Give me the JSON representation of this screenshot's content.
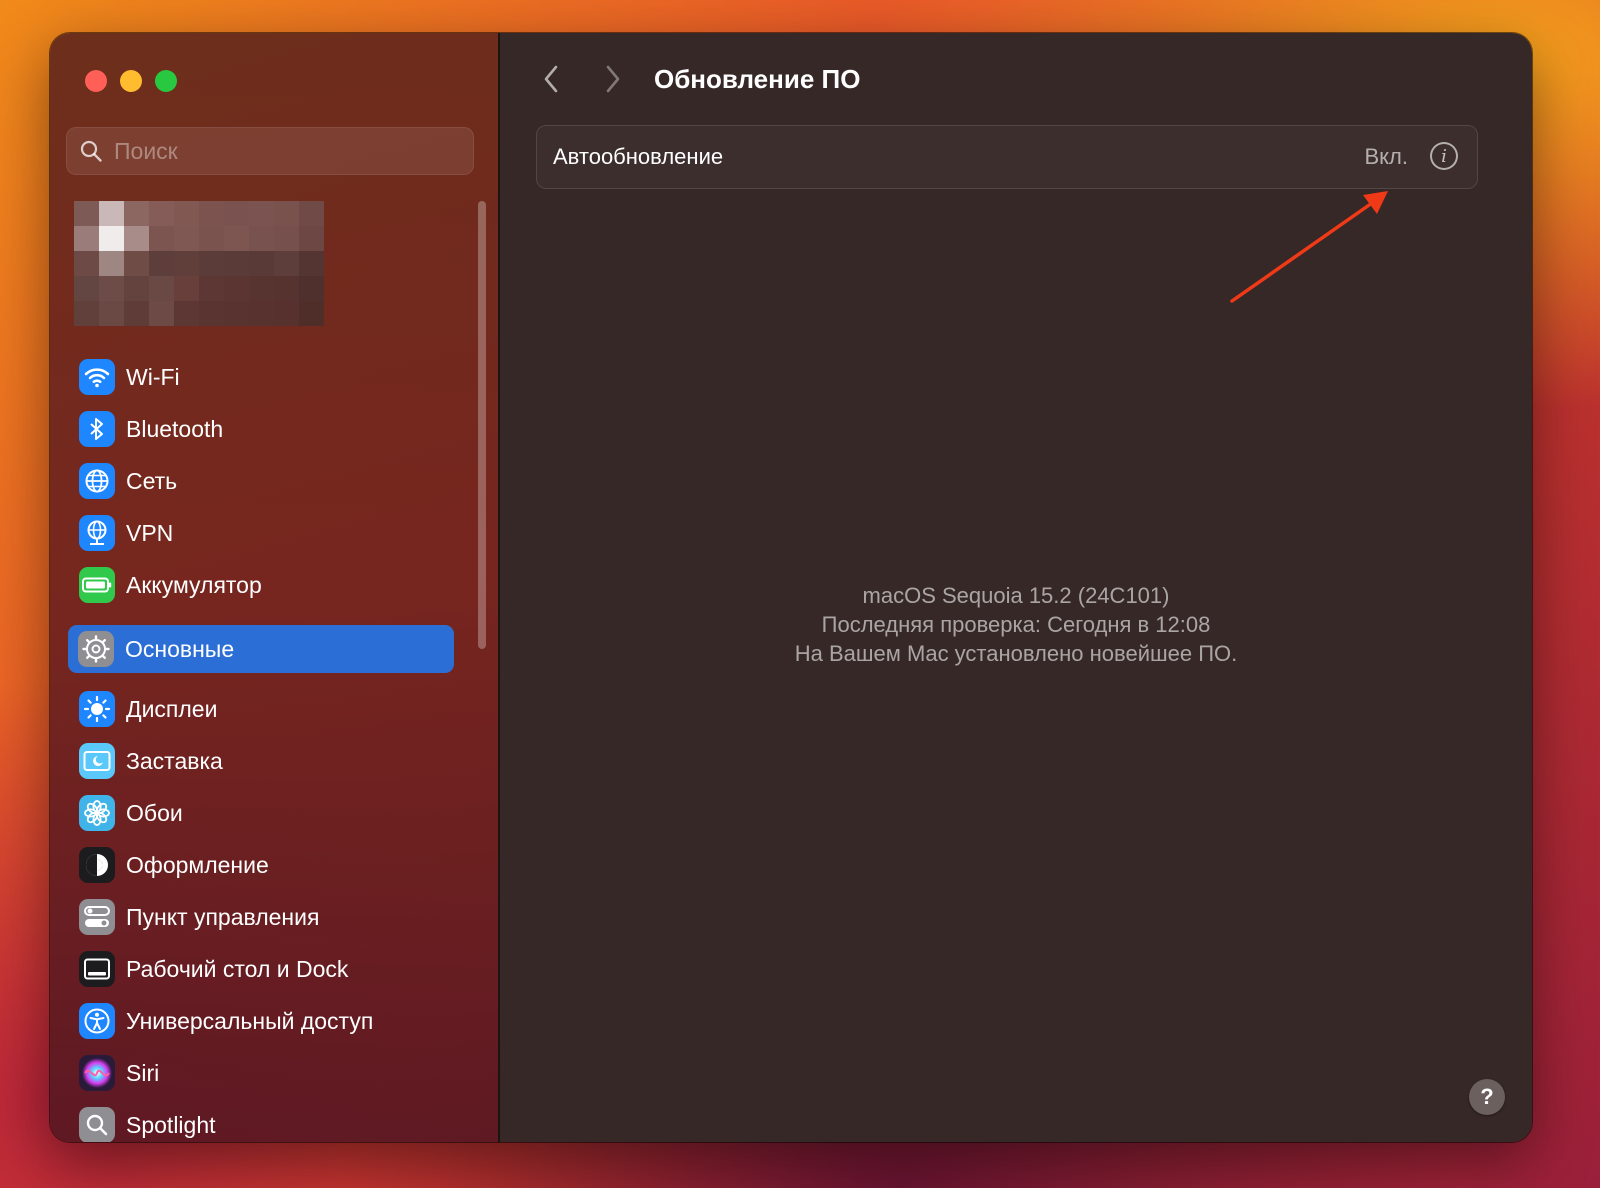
{
  "window": {
    "controls": [
      "close",
      "minimize",
      "zoom"
    ]
  },
  "sidebar": {
    "search": {
      "placeholder": "Поиск",
      "value": ""
    },
    "profile": {
      "blurred": true
    },
    "groups": [
      [
        {
          "label": "Wi-Fi",
          "icon": "wifi-icon",
          "color": "#1e86ff"
        },
        {
          "label": "Bluetooth",
          "icon": "bluetooth-icon",
          "color": "#1e86ff"
        },
        {
          "label": "Сеть",
          "icon": "globe-icon",
          "color": "#1e86ff"
        },
        {
          "label": "VPN",
          "icon": "vpn-globe-icon",
          "color": "#1e86ff"
        },
        {
          "label": "Аккумулятор",
          "icon": "battery-icon",
          "color": "#31c94b"
        }
      ],
      [
        {
          "label": "Основные",
          "icon": "gear-icon",
          "color": "#8e8e93",
          "selected": true
        },
        {
          "label": "Дисплеи",
          "icon": "sun-icon",
          "color": "#1e86ff"
        },
        {
          "label": "Заставка",
          "icon": "screensaver-icon",
          "color": "#5ac8fa"
        },
        {
          "label": "Обои",
          "icon": "flower-icon",
          "color": "#40b4e8"
        },
        {
          "label": "Оформление",
          "icon": "appearance-icon",
          "color": "#1c1c1e"
        },
        {
          "label": "Пункт управления",
          "icon": "control-center-icon",
          "color": "#8e8e93"
        },
        {
          "label": "Рабочий стол и Dock",
          "icon": "dock-icon",
          "color": "#1c1c1e"
        },
        {
          "label": "Универсальный доступ",
          "icon": "accessibility-icon",
          "color": "#1e86ff"
        },
        {
          "label": "Siri",
          "icon": "siri-icon",
          "color": "#2a1a3a"
        },
        {
          "label": "Spotlight",
          "icon": "spotlight-icon",
          "color": "#8e8e93"
        }
      ]
    ]
  },
  "main": {
    "title": "Обновление ПО",
    "auto_update": {
      "label": "Автообновление",
      "value": "Вкл."
    },
    "status": [
      "macOS Sequoia 15.2 (24C101)",
      "Последняя проверка: Сегодня в 12:08",
      "На Вашем Mac установлено новейшее ПО."
    ],
    "help_label": "?"
  },
  "annotation": {
    "arrow_color": "#f03a17"
  }
}
